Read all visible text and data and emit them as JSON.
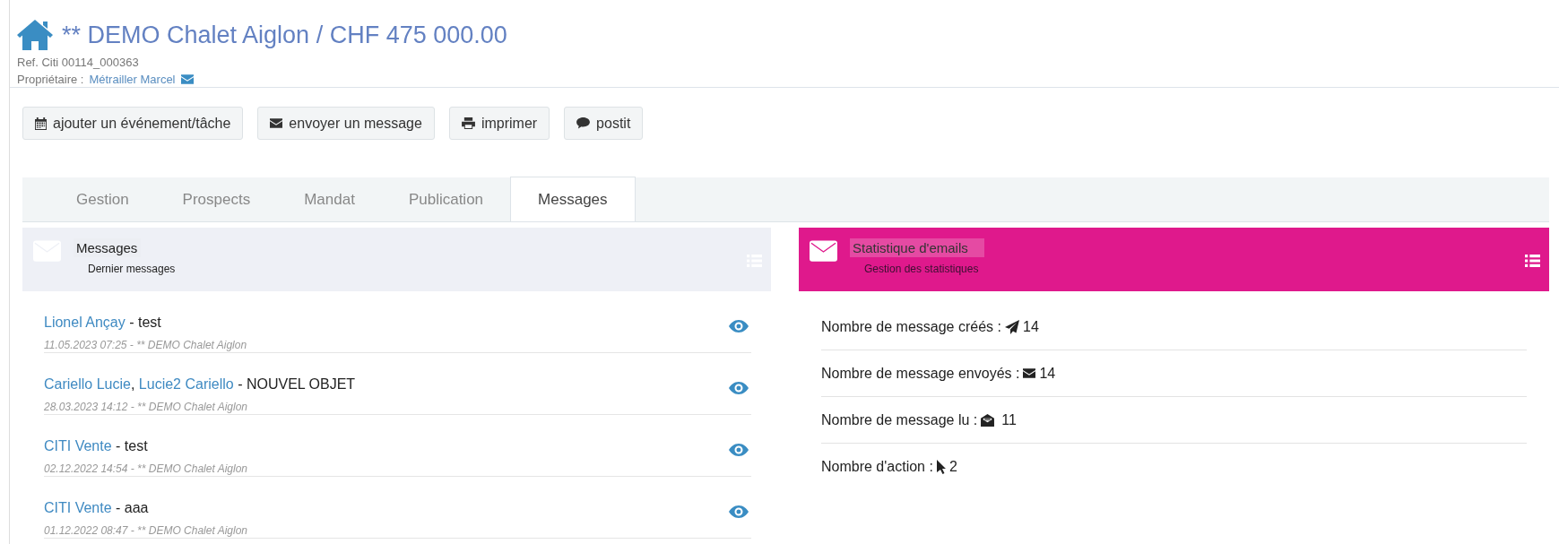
{
  "header": {
    "title": "** DEMO Chalet Aiglon / CHF 475 000.00",
    "ref": "Ref. Citi 00114_000363",
    "owner_label": "Propriétaire :",
    "owner_name": "Métrailler Marcel"
  },
  "actions": [
    {
      "kind": "calendar",
      "label": "ajouter un événement/tâche"
    },
    {
      "kind": "envelope",
      "label": "envoyer un message"
    },
    {
      "kind": "print",
      "label": "imprimer"
    },
    {
      "kind": "comment",
      "label": "postit"
    }
  ],
  "tabs": [
    {
      "label": "Gestion",
      "selected": false
    },
    {
      "label": "Prospects",
      "selected": false
    },
    {
      "label": "Mandat",
      "selected": false
    },
    {
      "label": "Publication",
      "selected": false
    },
    {
      "label": "Messages",
      "selected": true
    }
  ],
  "messages_panel": {
    "title": "Messages",
    "subtitle": "Dernier messages",
    "items": [
      {
        "senders": [
          {
            "name": "Lionel Ançay"
          }
        ],
        "subject": "- test",
        "meta": "11.05.2023 07:25 - ** DEMO Chalet Aiglon"
      },
      {
        "senders": [
          {
            "name": "Cariello Lucie",
            "separator": ","
          },
          {
            "name": "Lucie2 Cariello"
          }
        ],
        "subject": "- NOUVEL OBJET",
        "meta": "28.03.2023 14:12 - ** DEMO Chalet Aiglon"
      },
      {
        "senders": [
          {
            "name": "CITI Vente"
          }
        ],
        "subject": "- test",
        "meta": "02.12.2022 14:54 - ** DEMO Chalet Aiglon"
      },
      {
        "senders": [
          {
            "name": "CITI Vente"
          }
        ],
        "subject": "- aaa",
        "meta": "01.12.2022 08:47 - ** DEMO Chalet Aiglon"
      }
    ]
  },
  "stats_panel": {
    "title": "Statistique d'emails",
    "subtitle": "Gestion des statistiques",
    "items": [
      {
        "kind": "created",
        "label": "Nombre de message créés :",
        "value": "14"
      },
      {
        "kind": "sent",
        "label": "Nombre de message envoyés :",
        "value": "14"
      },
      {
        "kind": "read",
        "label": "Nombre de message lu :",
        "value": "11"
      },
      {
        "kind": "action",
        "label": "Nombre d'action :",
        "value": "2"
      }
    ]
  }
}
